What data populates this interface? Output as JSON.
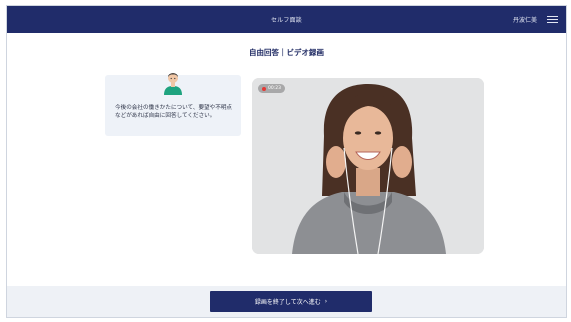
{
  "header": {
    "title": "セルフ面談",
    "user_name": "丹波仁美",
    "menu_icon": "hamburger-menu-icon"
  },
  "main": {
    "title": "自由回答｜ビデオ録画",
    "question": "今後の会社の働きかたについて、要望や不明点などがあれば自由に回答してください。",
    "avatar_icon": "interviewer-avatar-icon"
  },
  "video": {
    "recording_time": "00:23",
    "recording_indicator": "recording-dot-icon"
  },
  "footer": {
    "next_button_label": "録画を終了して次へ進む",
    "next_icon": "chevron-right-icon"
  },
  "colors": {
    "primary": "#202c6a",
    "recording": "#e53935",
    "panel": "#eef2f8",
    "avatar_shirt": "#1fa37f"
  }
}
